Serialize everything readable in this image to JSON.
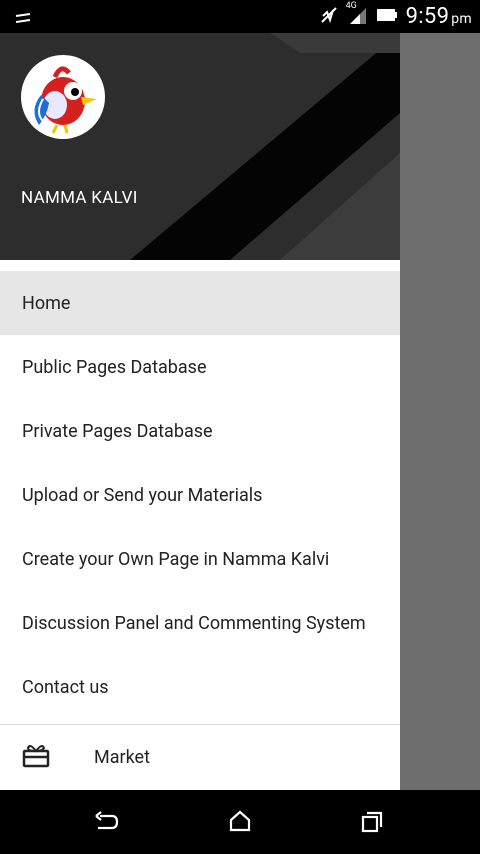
{
  "status_bar": {
    "time": "9:59",
    "ampm": "pm",
    "network": "4G",
    "icons": [
      "notification-icon",
      "mute-icon",
      "signal-icon",
      "battery-icon"
    ]
  },
  "drawer": {
    "header": {
      "app_name": "NAMMA KALVI",
      "logo": "bird-logo"
    },
    "items": [
      {
        "label": "Home",
        "active": true
      },
      {
        "label": "Public Pages Database"
      },
      {
        "label": "Private Pages Database"
      },
      {
        "label": "Upload or Send your Materials"
      },
      {
        "label": "Create your Own Page in Namma Kalvi"
      },
      {
        "label": "Discussion Panel and Commenting System"
      },
      {
        "label": "Contact us"
      }
    ],
    "market": {
      "label": "Market",
      "icon": "gift-card-icon"
    }
  },
  "nav_bar": {
    "buttons": [
      "back-icon",
      "home-icon",
      "recents-icon"
    ]
  },
  "colors": {
    "header_bg": "#2d2d2d",
    "active_item_bg": "#e6e6e6",
    "scrim": "#6e6e6e"
  }
}
